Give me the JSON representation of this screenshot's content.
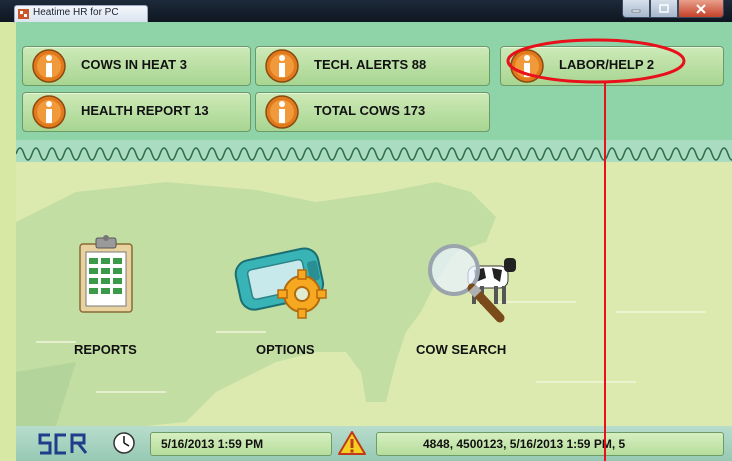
{
  "window": {
    "title": "Heatime HR for PC",
    "controls": [
      "minimize",
      "maximize",
      "close"
    ]
  },
  "alerts": [
    {
      "label": "COWS IN HEAT 3",
      "icon": "info-icon"
    },
    {
      "label": "TECH. ALERTS 88",
      "icon": "info-icon"
    },
    {
      "label": "LABOR/HELP 2",
      "icon": "info-icon"
    },
    {
      "label": "HEALTH REPORT 13",
      "icon": "info-icon"
    },
    {
      "label": "TOTAL COWS 173",
      "icon": "info-icon"
    }
  ],
  "menu": [
    {
      "label": "REPORTS",
      "icon": "clipboard-report-icon"
    },
    {
      "label": "OPTIONS",
      "icon": "device-gear-icon"
    },
    {
      "label": "COW SEARCH",
      "icon": "magnifier-cow-icon"
    }
  ],
  "status": {
    "logo": "SCR",
    "datetime": "5/16/2013 1:59 PM",
    "message": "4848, 4500123, 5/16/2013 1:59 PM, 5",
    "clock_icon": "clock-icon",
    "warning_icon": "warning-icon"
  },
  "colors": {
    "panel_green": "#8fd3a8",
    "button_green": "#b8dea2",
    "info_orange": "#e07a1c",
    "annotation_red": "#e8101a"
  }
}
